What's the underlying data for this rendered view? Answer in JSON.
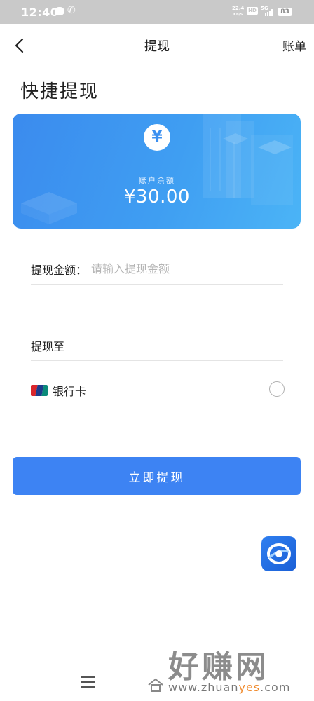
{
  "status_bar": {
    "time": "12:40",
    "speed_value": "22.4",
    "speed_unit": "KB/S",
    "hd": "HD",
    "network": "5G",
    "battery": "83"
  },
  "nav": {
    "title": "提现",
    "bill_label": "账单"
  },
  "heading": "快捷提现",
  "card": {
    "currency_symbol": "¥",
    "balance_label": "账户余额",
    "balance_amount": "¥30.00"
  },
  "form": {
    "amount_label": "提现金额：",
    "amount_value": "",
    "amount_placeholder": "请输入提现金额",
    "withdraw_to_label": "提现至",
    "bank_option_label": "银行卡",
    "bank_option_selected": false
  },
  "submit_label": "立即提现",
  "watermark": {
    "brand": "好赚网",
    "url_prefix": "www.zhuan",
    "url_highlight": "yes",
    "url_suffix": ".com"
  },
  "colors": {
    "accent": "#3d83f3",
    "card_start": "#3b8bee",
    "card_end": "#4bb4f6",
    "watermark_highlight": "#f08a2c"
  },
  "icons": [
    "back-icon",
    "yen-icon",
    "unionpay-icon",
    "radio-icon",
    "app-logo-icon",
    "menu-icon",
    "home-icon",
    "chat-icon",
    "phone-icon"
  ]
}
